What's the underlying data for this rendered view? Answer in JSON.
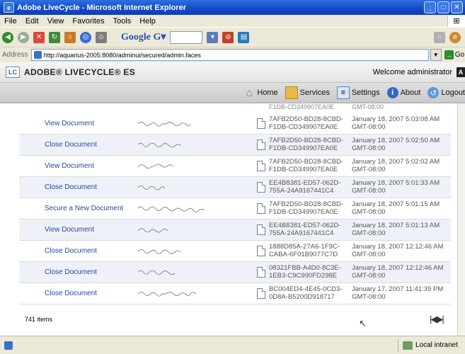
{
  "window": {
    "title": "Adobe LiveCycle - Microsoft Internet Explorer",
    "controls": [
      "_",
      "□",
      "✕"
    ]
  },
  "menu": [
    "File",
    "Edit",
    "View",
    "Favorites",
    "Tools",
    "Help"
  ],
  "toolbar": {
    "google_label": "Google G▾"
  },
  "address": {
    "label": "Address",
    "url": "http://aquarius-2005:8080/adminui/secured/admin.faces",
    "go_label": "Go"
  },
  "header": {
    "product": "ADOBE® LIVECYCLE® ES",
    "logo_text": "LC",
    "welcome": "Welcome administrator"
  },
  "nav": [
    {
      "label": "Home",
      "icon": "home-icon"
    },
    {
      "label": "Services",
      "icon": "services-icon"
    },
    {
      "label": "Settings",
      "icon": "settings-icon"
    },
    {
      "label": "About",
      "icon": "about-icon"
    },
    {
      "label": "Logout",
      "icon": "logout-icon"
    }
  ],
  "partial_row": {
    "docid": "F1DB-CD349907EA0E",
    "date": "GMT-08:00"
  },
  "rows": [
    {
      "action": "View Document",
      "docid": "7AFB2D50-BD28-8CBD-F1DB-CD349907EA0E",
      "date": "January 18, 2007 5:03:08 AM GMT-08:00"
    },
    {
      "action": "Close Document",
      "docid": "7AFB2D50-BD28-8CBD-F1DB-CD349907EA0E",
      "date": "January 18, 2007 5:02:50 AM GMT-08:00"
    },
    {
      "action": "View Document",
      "docid": "7AFB2D50-BD28-8CBD-F1DB-CD349907EA0E",
      "date": "January 18, 2007 5:02:02 AM GMT-08:00"
    },
    {
      "action": "Close Document",
      "docid": "EE4B8381-ED57-062D-755A-24A9167441C4",
      "date": "January 18, 2007 5:01:33 AM GMT-08:00"
    },
    {
      "action": "Secure a New Document",
      "docid": "7AFB2D50-BD28-8CBD-F1DB-CD349907EA0E",
      "date": "January 18, 2007 5:01:15 AM GMT-08:00"
    },
    {
      "action": "View Document",
      "docid": "EE4B8381-ED57-062D-755A-24A9167441C4",
      "date": "January 18, 2007 5:01:13 AM GMT-08:00"
    },
    {
      "action": "Close Document",
      "docid": "1888D85A-27A6-1F9C-CABA-6F01B9077C7D",
      "date": "January 18, 2007 12:12:46 AM GMT-08:00"
    },
    {
      "action": "Close Document",
      "docid": "08321FBB-A4D0-8C3E-1EB3-C9C990FD298E",
      "date": "January 18, 2007 12:12:46 AM GMT-08:00"
    },
    {
      "action": "Close Document",
      "docid": "BC004ED4-4E45-0CD3-0D8A-B5200D918717",
      "date": "January 17, 2007 11:41:39 PM GMT-08:00"
    }
  ],
  "footer": {
    "count": "741 items"
  },
  "status": {
    "zone": "Local intranet"
  }
}
